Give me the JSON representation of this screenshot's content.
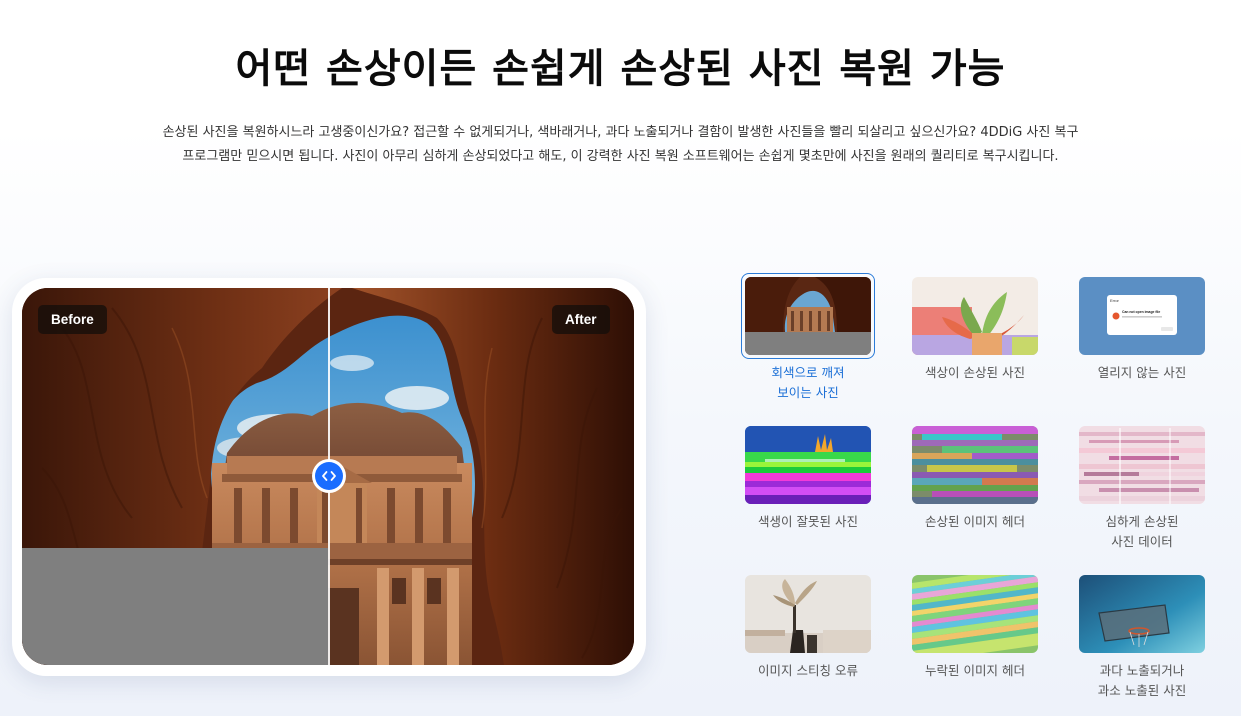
{
  "header": {
    "title": "어떤 손상이든 손쉽게 손상된 사진 복원 가능",
    "description": "손상된 사진을 복원하시느라 고생중이신가요? 접근할 수 없게되거나, 색바래거나, 과다 노출되거나 결함이 발생한 사진들을 빨리 되살리고 싶으신가요? 4DDiG 사진 복구 프로그램만 믿으시면 됩니다. 사진이 아무리 심하게 손상되었다고 해도, 이 강력한 사진 복원 소프트웨어는 손쉽게 몇초만에 사진을 원래의 퀄리티로 복구시킵니다."
  },
  "viewer": {
    "before_label": "Before",
    "after_label": "After",
    "slider_percent": 50
  },
  "damage_types": [
    {
      "label": "회색으로 깨져\n보이는 사진",
      "active": true,
      "icon": "gray-broken-photo"
    },
    {
      "label": "색상이 손상된 사진",
      "active": false,
      "icon": "color-damaged-photo"
    },
    {
      "label": "열리지 않는 사진",
      "active": false,
      "icon": "unopenable-photo"
    },
    {
      "label": "색생이 잘못된 사진",
      "active": false,
      "icon": "wrong-color-photo"
    },
    {
      "label": "손상된 이미지 헤더",
      "active": false,
      "icon": "damaged-header"
    },
    {
      "label": "심하게 손상된\n사진 데이터",
      "active": false,
      "icon": "severe-damage"
    },
    {
      "label": "이미지 스티칭 오류",
      "active": false,
      "icon": "stitching-error"
    },
    {
      "label": "누락된 이미지 헤더",
      "active": false,
      "icon": "missing-header"
    },
    {
      "label": "과다 노출되거나\n과소 노출된 사진",
      "active": false,
      "icon": "exposure-photo"
    }
  ],
  "error_dialog": {
    "title": "Error",
    "message": "Can not open image file"
  },
  "colors": {
    "accent": "#1b6fd6",
    "handle": "#1a6dff",
    "gray_damage": "#7f7f7f"
  }
}
